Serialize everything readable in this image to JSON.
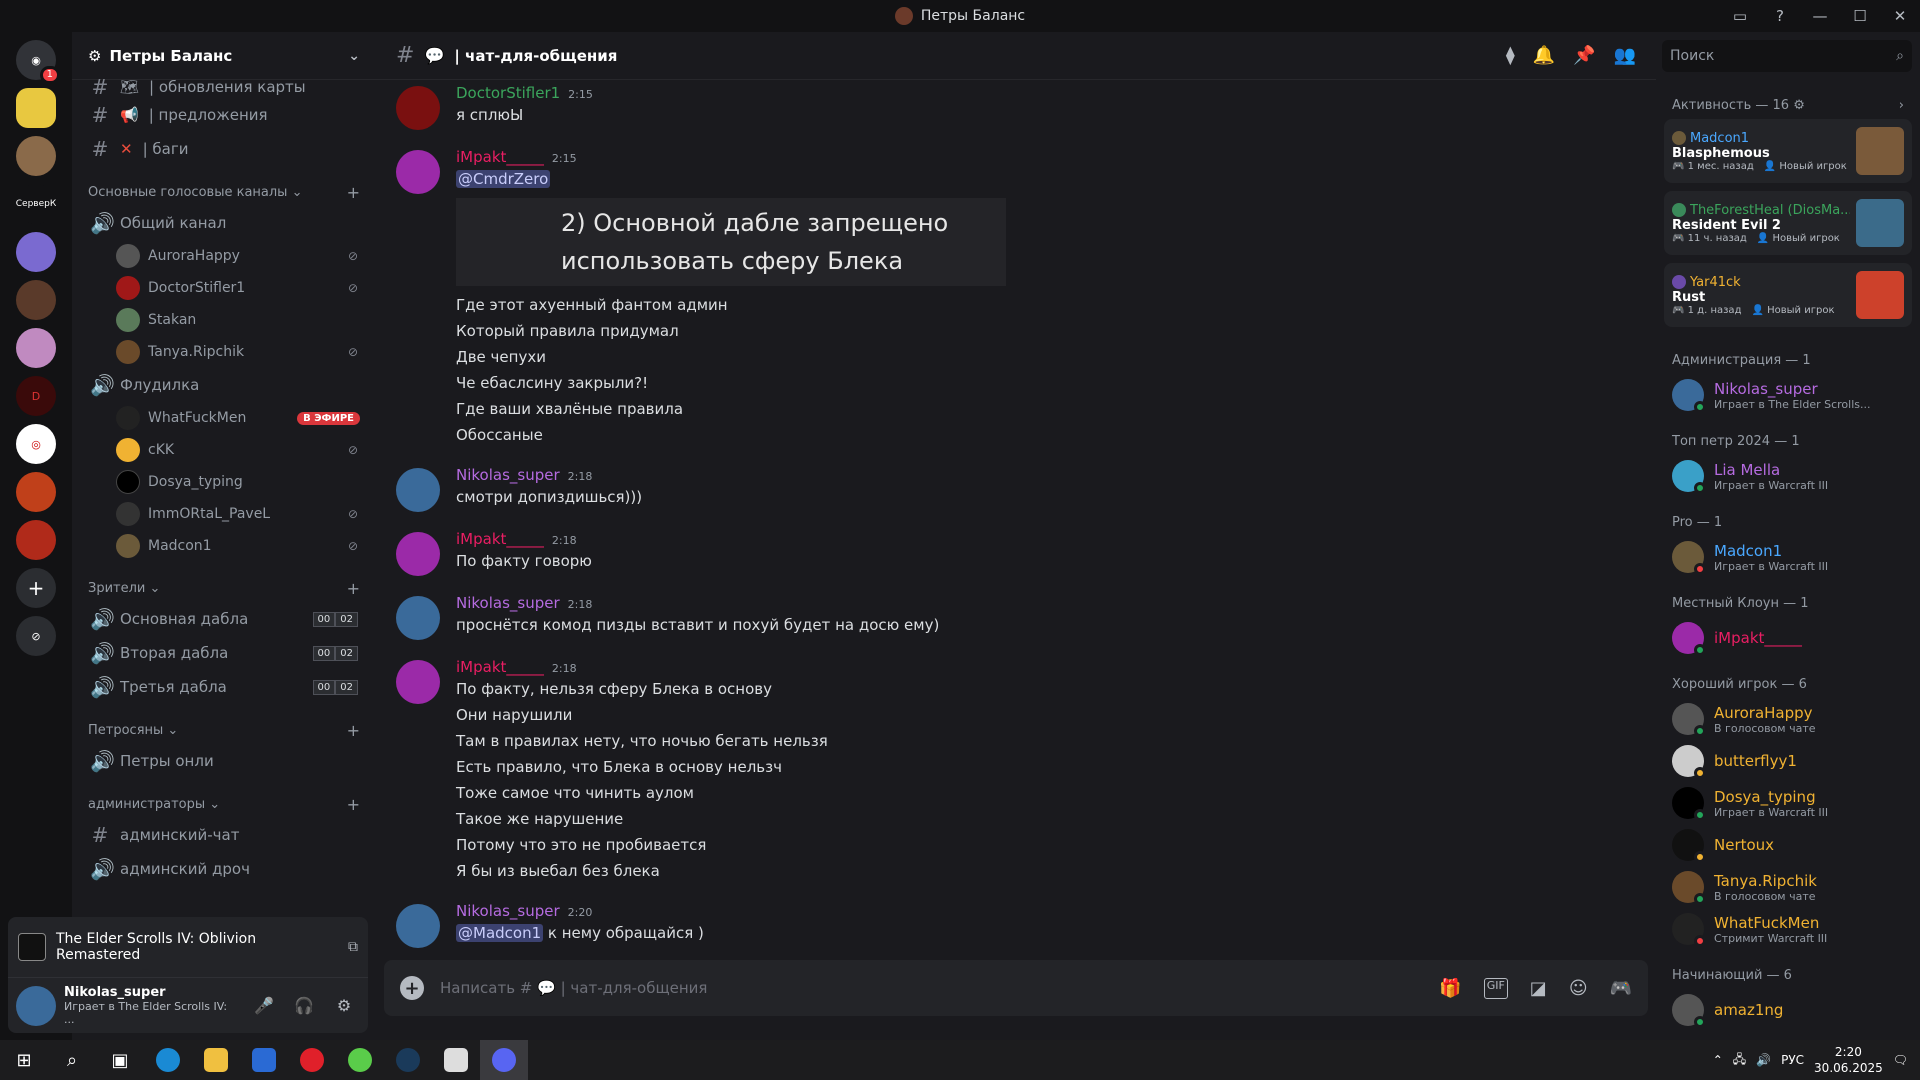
{
  "window": {
    "title": "Петры Баланс"
  },
  "server": {
    "name": "Петры Баланс"
  },
  "guild_badge": "1",
  "guild_labels": {
    "text_server": "СерверК"
  },
  "channels": {
    "top": [
      {
        "name": "| обновления карты",
        "icon": "map-icon"
      },
      {
        "name": "| предложения",
        "icon": "megaphone-icon"
      },
      {
        "name": "| баги",
        "icon": "cross-icon"
      }
    ],
    "voice_category": "Основные голосовые каналы",
    "general_voice": "Общий канал",
    "general_users": [
      "AuroraHappy",
      "DoctorStifler1",
      "Stakan",
      "Tanya.Ripchik"
    ],
    "flood_voice": "Флудилка",
    "flood_users": [
      "WhatFuckMen",
      "cKK",
      "Dosya_typing",
      "ImmORtaL_PaveL",
      "Madcon1"
    ],
    "live_label": "В ЭФИРЕ",
    "viewers_category": "Зрители",
    "viewers": [
      {
        "name": "Основная дабла",
        "a": "00",
        "b": "02"
      },
      {
        "name": "Вторая дабла",
        "a": "00",
        "b": "02"
      },
      {
        "name": "Третья дабла",
        "a": "00",
        "b": "02"
      }
    ],
    "petrosyans_category": "Петросяны",
    "petrosyans_channel": "Петры онли",
    "admin_category": "администраторы",
    "admin_chat": "админский-чат",
    "admin_voice": "админский дроч"
  },
  "voice_panel": {
    "game": "The Elder Scrolls IV: Oblivion Remastered"
  },
  "me": {
    "name": "Nikolas_super",
    "status": "Играет в The Elder Scrolls IV: ..."
  },
  "chat": {
    "channel": "| чат-для-общения",
    "search_placeholder": "Поиск"
  },
  "messages": [
    {
      "author": "DoctorStifler1",
      "time": "2:15",
      "color": "#3ba55c",
      "lines": [
        "я сплюЫ"
      ]
    },
    {
      "author": "iMpakt_____",
      "time": "2:15",
      "color": "#e91e63",
      "mention": "@CmdrZero",
      "embed_lines": [
        "2) Основной дабле запрещено",
        "использовать сферу Блека"
      ],
      "lines": [
        "Где этот ахуенный фантом админ",
        "Который правила придумал",
        "Две чепухи",
        "Че ебаслсину закрыли?!",
        "Где ваши  хвалёные правила",
        "Обоссаные"
      ]
    },
    {
      "author": "Nikolas_super",
      "time": "2:18",
      "color": "#b56be0",
      "lines": [
        "смотри допиздишься)))"
      ]
    },
    {
      "author": "iMpakt_____",
      "time": "2:18",
      "color": "#e91e63",
      "lines": [
        "По факту говорю"
      ]
    },
    {
      "author": "Nikolas_super",
      "time": "2:18",
      "color": "#b56be0",
      "lines": [
        "проснётся комод пизды вставит и похуй будет на досю ему)"
      ]
    },
    {
      "author": "iMpakt_____",
      "time": "2:18",
      "color": "#e91e63",
      "lines": [
        "По факту, нельзя сферу Блека в основу",
        "Они нарушили",
        "Там в правилах нету, что ночью бегать нельзя",
        "Есть правило, что Блека в основу нельзч",
        "Тоже самое что чинить аулом",
        "Такое же нарушение",
        "Потому что это не пробивается",
        "Я бы из выебал без блека"
      ]
    },
    {
      "author": "Nikolas_super",
      "time": "2:20",
      "color": "#b56be0",
      "mention": "@Madcon1",
      "mention_rest": " к нему обращайся )"
    }
  ],
  "composer": {
    "placeholder": "Написать #",
    "channel": "| чат-для-общения"
  },
  "members": {
    "activity_header": "Активность — 16",
    "activities": [
      {
        "user": "Madcon1",
        "ucolor": "#4aa8ff",
        "game": "Blasphemous",
        "ago": "1 мес. назад",
        "tag": "Новый игрок",
        "thumb": "#7a5a3a"
      },
      {
        "user": "TheForestHeal (DiosMa...",
        "ucolor": "#3ba55c",
        "game": "Resident Evil 2",
        "ago": "11 ч. назад",
        "tag": "Новый игрок",
        "thumb": "#3b6b8a"
      },
      {
        "user": "Yar41ck",
        "ucolor": "#f0b232",
        "game": "Rust",
        "ago": "1 д. назад",
        "tag": "Новый игрок",
        "thumb": "#cd412b"
      }
    ],
    "groups": [
      {
        "title": "Администрация — 1",
        "people": [
          {
            "name": "Nikolas_super",
            "color": "#b56be0",
            "status": "Играет в The Elder Scrolls...",
            "dot": "#23a55a",
            "av": "#3a6a9a"
          }
        ]
      },
      {
        "title": "Топ петр 2024 — 1",
        "people": [
          {
            "name": "Lia Mella",
            "color": "#b56be0",
            "status": "Играет в Warcraft III",
            "dot": "#23a55a",
            "av": "#3aa0c8"
          }
        ]
      },
      {
        "title": "Pro — 1",
        "people": [
          {
            "name": "Madcon1",
            "color": "#4aa8ff",
            "status": "Играет в Warcraft III",
            "dot": "#f23f43",
            "av": "#6b5a3a"
          }
        ]
      },
      {
        "title": "Местный Клоун — 1",
        "people": [
          {
            "name": "iMpakt_____",
            "color": "#e91e63",
            "status": "",
            "dot": "#23a55a",
            "av": "#9b2aa8"
          }
        ]
      },
      {
        "title": "Хороший игрок — 6",
        "people": [
          {
            "name": "AuroraHappy",
            "color": "#f0b232",
            "status": "В голосовом чате",
            "dot": "#23a55a",
            "av": "#555"
          },
          {
            "name": "butterflyy1",
            "color": "#f0b232",
            "status": "",
            "dot": "#f0b232",
            "av": "#ccc"
          },
          {
            "name": "Dosya_typing",
            "color": "#f0b232",
            "status": "Играет в Warcraft III",
            "dot": "#23a55a",
            "av": "#000"
          },
          {
            "name": "Nertoux",
            "color": "#f0b232",
            "status": "",
            "dot": "#f0b232",
            "av": "#111"
          },
          {
            "name": "Tanya.Ripchik",
            "color": "#f0b232",
            "status": "В голосовом чате",
            "dot": "#23a55a",
            "av": "#6a4a2a"
          },
          {
            "name": "WhatFuckMen",
            "color": "#f0b232",
            "status": "Стримит Warcraft III",
            "dot": "#f23f43",
            "av": "#222"
          }
        ]
      },
      {
        "title": "Начинающий — 6",
        "people": [
          {
            "name": "amaz1ng",
            "color": "#f0b232",
            "status": "",
            "dot": "#23a55a",
            "av": "#555"
          }
        ]
      }
    ]
  },
  "taskbar": {
    "lang": "РУС",
    "time": "2:20",
    "date": "30.06.2025"
  }
}
